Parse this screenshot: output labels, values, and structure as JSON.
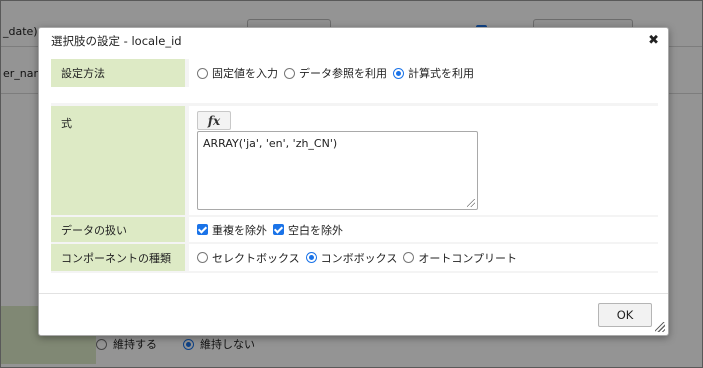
{
  "background": {
    "cell_top_left": "_date)",
    "cell_second_left": "er_nam",
    "radio_options": [
      {
        "label": "維持する",
        "selected": false
      },
      {
        "label": "維持しない",
        "selected": true
      }
    ]
  },
  "dialog": {
    "title": "選択肢の設定 - locale_id",
    "close_symbol": "✖",
    "setting_method": {
      "label": "設定方法",
      "options": [
        {
          "label": "固定値を入力",
          "selected": false
        },
        {
          "label": "データ参照を利用",
          "selected": false
        },
        {
          "label": "計算式を利用",
          "selected": true
        }
      ]
    },
    "formula": {
      "label": "式",
      "fx_button": "fx",
      "value": "ARRAY('ja', 'en', 'zh_CN')"
    },
    "data_handling": {
      "label": "データの扱い",
      "options": [
        {
          "label": "重複を除外",
          "checked": true
        },
        {
          "label": "空白を除外",
          "checked": true
        }
      ]
    },
    "component_type": {
      "label": "コンポーネントの種類",
      "options": [
        {
          "label": "セレクトボックス",
          "selected": false
        },
        {
          "label": "コンボボックス",
          "selected": true
        },
        {
          "label": "オートコンプリート",
          "selected": false
        }
      ]
    },
    "ok_button": "OK"
  },
  "colors": {
    "accent": "#1a73e8",
    "label_bg": "#ddeac5",
    "overlay": "rgba(0,0,0,0.42)"
  }
}
